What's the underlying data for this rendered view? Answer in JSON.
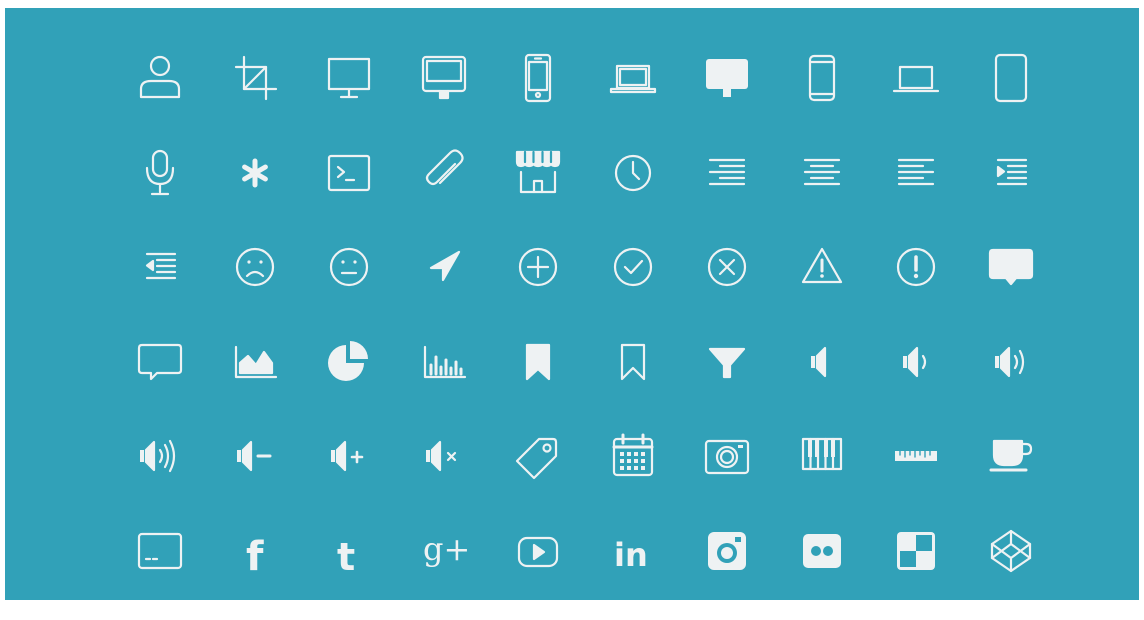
{
  "icon_set": {
    "background_color": "#31a1b8",
    "icon_color": "#eef2f3",
    "rows": [
      [
        "user-icon",
        "crop-icon",
        "monitor-icon",
        "imac-icon",
        "iphone-icon",
        "laptop-icon",
        "display-filled-icon",
        "phone-filled-icon",
        "laptop-outline-icon",
        "tablet-icon"
      ],
      [
        "microphone-icon",
        "asterisk-icon",
        "terminal-icon",
        "paperclip-icon",
        "store-icon",
        "clock-icon",
        "align-right-icon",
        "align-center-icon",
        "align-left-icon",
        "indent-icon"
      ],
      [
        "outdent-icon",
        "sad-face-icon",
        "neutral-face-icon",
        "location-arrow-icon",
        "plus-circle-icon",
        "check-circle-icon",
        "close-circle-icon",
        "warning-triangle-icon",
        "exclamation-circle-icon",
        "chat-bubble-filled-icon"
      ],
      [
        "chat-bubble-outline-icon",
        "area-chart-icon",
        "pie-chart-icon",
        "bar-chart-icon",
        "bookmark-filled-icon",
        "bookmark-outline-icon",
        "filter-icon",
        "volume-off-icon",
        "volume-low-icon",
        "volume-medium-icon"
      ],
      [
        "volume-high-icon",
        "volume-down-icon",
        "volume-up-icon",
        "volume-mute-icon",
        "tag-icon",
        "calendar-icon",
        "camera-icon",
        "piano-icon",
        "ruler-icon",
        "coffee-cup-icon"
      ],
      [
        "subtitles-icon",
        "facebook-icon",
        "twitter-icon",
        "google-plus-icon",
        "youtube-icon",
        "linkedin-icon",
        "instagram-icon",
        "flickr-icon",
        "delicious-icon",
        "codepen-icon"
      ]
    ],
    "glyph_text": {
      "facebook": "f",
      "twitter": "t",
      "google_plus": "g+",
      "linkedin": "in"
    }
  }
}
